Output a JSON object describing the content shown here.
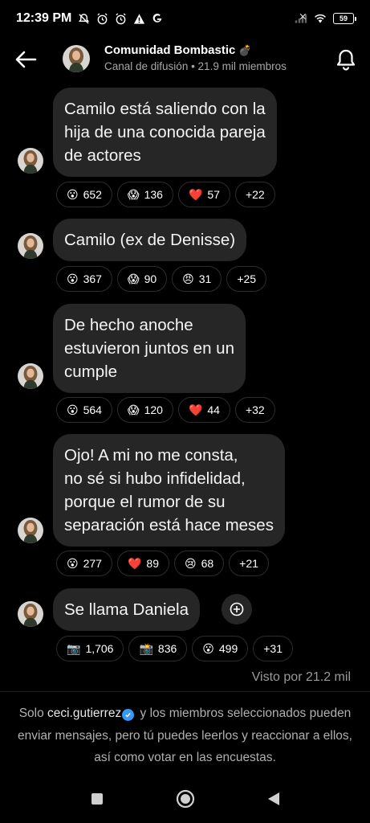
{
  "status_bar": {
    "time": "12:39 PM",
    "battery": "59"
  },
  "header": {
    "channel_name": "Comunidad Bombastic",
    "channel_emoji": "💣",
    "subtitle": "Canal de difusión • 21.9 mil miembros"
  },
  "messages": [
    {
      "text": "Camilo está saliendo con la\nhija de una conocida pareja\nde actores",
      "reactions": [
        {
          "emoji": "😮",
          "count": "652"
        },
        {
          "emoji": "😱",
          "count": "136"
        },
        {
          "emoji": "❤️",
          "count": "57"
        }
      ],
      "more": "+22"
    },
    {
      "text": "Camilo (ex de Denisse)",
      "reactions": [
        {
          "emoji": "😮",
          "count": "367"
        },
        {
          "emoji": "😱",
          "count": "90"
        },
        {
          "emoji": "😠",
          "count": "31"
        }
      ],
      "more": "+25"
    },
    {
      "text": "De hecho anoche\nestuvieron juntos  en un\ncumple",
      "reactions": [
        {
          "emoji": "😮",
          "count": "564"
        },
        {
          "emoji": "😱",
          "count": "120"
        },
        {
          "emoji": "❤️",
          "count": "44"
        }
      ],
      "more": "+32"
    },
    {
      "text": "Ojo! A mi no me consta,\nno sé si hubo infidelidad,\nporque el rumor de su\nseparación está hace meses",
      "reactions": [
        {
          "emoji": "😮",
          "count": "277"
        },
        {
          "emoji": "❤️",
          "count": "89"
        },
        {
          "emoji": "😢",
          "count": "68"
        }
      ],
      "more": "+21"
    },
    {
      "text": "Se llama Daniela",
      "reactions": [
        {
          "emoji": "📷",
          "count": "1,706"
        },
        {
          "emoji": "📸",
          "count": "836"
        },
        {
          "emoji": "😮",
          "count": "499"
        }
      ],
      "more": "+31"
    }
  ],
  "seen_by": "Visto por 21.2 mil",
  "footer": {
    "prefix": "Solo ",
    "username": "ceci.gutierrez",
    "text": " y los miembros seleccionados pueden enviar mensajes, pero tú puedes leerlos y reaccionar a ellos, así como votar en las encuestas."
  },
  "colors": {
    "background": "#000000",
    "bubble": "#262626",
    "verified": "#3897f0"
  },
  "icons": [
    "back-arrow-icon",
    "notification-bell-icon",
    "share-icon",
    "home-icon",
    "recents-icon",
    "nav-back-icon",
    "verified-badge-icon"
  ]
}
